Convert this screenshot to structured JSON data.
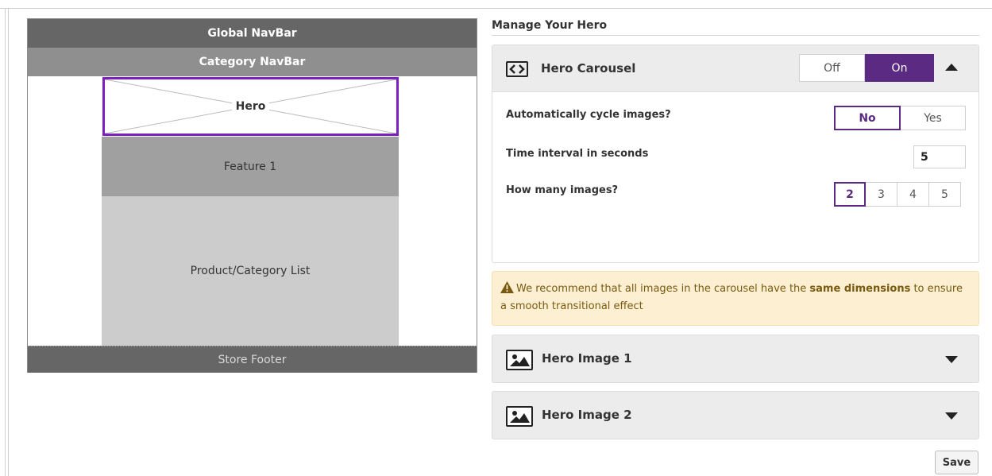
{
  "preview": {
    "global_nav": "Global NavBar",
    "category_nav": "Category NavBar",
    "hero": "Hero",
    "feature": "Feature 1",
    "product_list": "Product/Category List",
    "footer": "Store Footer",
    "selected_color": "#7a1fc0"
  },
  "panel": {
    "title": "Manage Your Hero",
    "carousel": {
      "title": "Hero Carousel",
      "icon": "code-brackets-icon",
      "toggle": {
        "off_label": "Off",
        "on_label": "On",
        "selected": "On"
      },
      "cycle": {
        "label": "Automatically cycle images?",
        "no_label": "No",
        "yes_label": "Yes",
        "selected": "No"
      },
      "interval": {
        "label": "Time interval in seconds",
        "value": "5"
      },
      "count": {
        "label": "How many images?",
        "options": [
          "2",
          "3",
          "4",
          "5"
        ],
        "selected": "2"
      }
    },
    "warning": {
      "icon": "warning-triangle-icon",
      "text_before": "We recommend that all images in the carousel have the ",
      "emphasis": "same dimensions",
      "text_after": " to ensure a smooth transitional effect"
    },
    "images": [
      {
        "title": "Hero Image 1",
        "icon": "image-icon"
      },
      {
        "title": "Hero Image 2",
        "icon": "image-icon"
      }
    ],
    "save_label": "Save"
  },
  "colors": {
    "accent": "#5b2b83",
    "warning_bg": "#fcefd2",
    "header_bg": "#ececec"
  }
}
